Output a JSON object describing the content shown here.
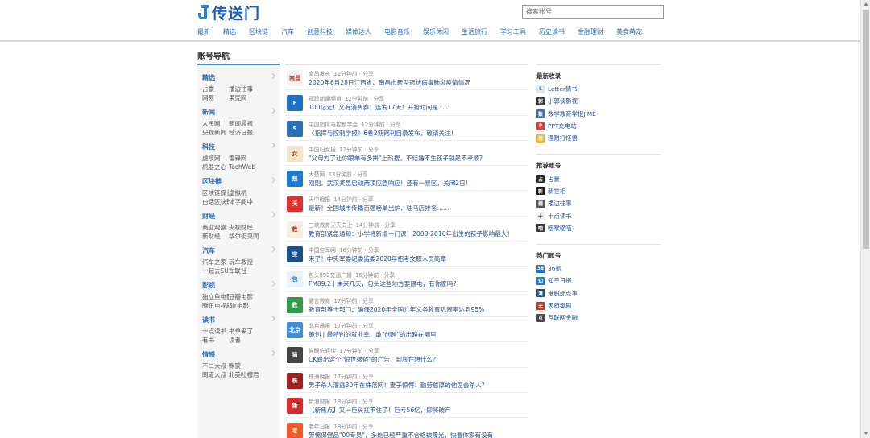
{
  "header": {
    "logo_text": "传送门",
    "search_placeholder": "搜索账号",
    "nav": [
      "最新",
      "精选",
      "区块链",
      "汽车",
      "创意科技",
      "媒体达人",
      "电影音乐",
      "娱乐休闲",
      "生活旅行",
      "学习工具",
      "历史读书",
      "金融理财",
      "美食萌宠"
    ]
  },
  "sidebar": {
    "title": "账号导航",
    "categories": [
      {
        "name": "精选",
        "links": [
          "占豪",
          "播边往事",
          "网易",
          "果壳网"
        ]
      },
      {
        "name": "新闻",
        "links": [
          "人民网",
          "新闻晨报",
          "央视新闻",
          "经济日报"
        ]
      },
      {
        "name": "科技",
        "links": [
          "虎嗅网",
          "雷锋网",
          "机器之心",
          "TechWeb"
        ]
      },
      {
        "name": "区块链",
        "links": [
          "区块链探长",
          "虚拟机",
          "白话区块链",
          "体字阁中"
        ]
      },
      {
        "name": "财经",
        "links": [
          "商业观察",
          "央视财经",
          "新财经",
          "华尔街见闻"
        ]
      },
      {
        "name": "汽车",
        "links": [
          "汽车之家",
          "玩车教授",
          "一起去SUV",
          "车联社"
        ]
      },
      {
        "name": "影视",
        "links": [
          "独立鱼电影",
          "豆瓣电影",
          "腾讯电视剧",
          "Sir电影"
        ]
      },
      {
        "name": "读书",
        "links": [
          "十点读书",
          "书单来了",
          "有书",
          "读者"
        ]
      },
      {
        "name": "情感",
        "links": [
          "不二大叔",
          "咪蒙",
          "同道大叔",
          "北美吐槽君"
        ]
      }
    ]
  },
  "feed": [
    {
      "source": "南昌发布",
      "time": "12分钟前",
      "share": "分享",
      "title": "2020年6月28日江西省、南昌市新型冠状病毒肺炎疫情情况",
      "icon_text": "南昌",
      "icon_color": "#f2f2f2",
      "icon_fg": "#c0392b"
    },
    {
      "source": "福建新闻频道",
      "time": "12分钟前",
      "share": "分享",
      "title": "100亿元！又有消费券！连发17天！开抢时间是……",
      "icon_text": "F",
      "icon_color": "#1f6fc5",
      "icon_fg": "#ffffff"
    },
    {
      "source": "中国指挥与控制学会",
      "time": "12分钟前",
      "share": "分享",
      "title": "《指挥与控制学报》6卷2期网刊目录发布，敬请关注！",
      "icon_text": "S",
      "icon_color": "#2d6fb7",
      "icon_fg": "#ffffff"
    },
    {
      "source": "中国妇女报",
      "time": "12分钟前",
      "share": "分享",
      "title": "\"父母为了让你眼单有多拼\"上热搜，不结婚不生孩子就是不孝顺？",
      "icon_text": "女",
      "icon_color": "#f3e3c8",
      "icon_fg": "#c0392b"
    },
    {
      "source": "大楚网",
      "time": "13分钟前",
      "share": "分享",
      "title": "刚刚，武汉紧急启动两项应急响应！还有一景区，关闭2日！",
      "icon_text": "楚",
      "icon_color": "#1c7ad0",
      "icon_fg": "#ffffff"
    },
    {
      "source": "天中晚报",
      "time": "14分钟前",
      "share": "分享",
      "title": "最新！全国城市传播百强榜单出炉，驻马店排名……",
      "icon_text": "天",
      "icon_color": "#e03131",
      "icon_fg": "#ffffff"
    },
    {
      "source": "三峡教育天天向上",
      "time": "14分钟前",
      "share": "分享",
      "title": "教育部紧急通知：小学将新增一门课！2008-2016年出生的孩子影响最大！",
      "icon_text": "教",
      "icon_color": "#f7efe0",
      "icon_fg": "#b33"
    },
    {
      "source": "中国空军网",
      "time": "16分钟前",
      "share": "分享",
      "title": "来了！中央军委纪委监委2020年招考文职人员简章",
      "icon_text": "空",
      "icon_color": "#1b4f8c",
      "icon_fg": "#ffffff"
    },
    {
      "source": "包头892交通广播",
      "time": "16分钟前",
      "share": "分享",
      "title": "FM89.2 | 未来几天，包头这些地方要限电，有你家吗?",
      "icon_text": "包",
      "icon_color": "#eaf3fb",
      "icon_fg": "#1c7ad0"
    },
    {
      "source": "微言教育",
      "time": "17分钟前",
      "share": "分享",
      "title": "教育部等十部门：确保2020年全国九年义务教育巩固率达到95%",
      "icon_text": "教",
      "icon_color": "#2e9a4a",
      "icon_fg": "#ffffff"
    },
    {
      "source": "北京晨报",
      "time": "17分钟前",
      "share": "分享",
      "title": "策划 | 最特别的就业季，敢\"创跨\"的出路在哪里",
      "icon_text": "北京",
      "icon_color": "#3f8fd6",
      "icon_fg": "#ffffff"
    },
    {
      "source": "猫眼佐轻谈",
      "time": "17分钟前",
      "share": "分享",
      "title": "CK跟出这个\"惊世骇俗\"的广告，到底在想什么？",
      "icon_text": "猫",
      "icon_color": "#444444",
      "icon_fg": "#ffffff"
    },
    {
      "source": "株洲晚报",
      "time": "17分钟前",
      "share": "分享",
      "title": "男子杀人潜逃30年在株落网！妻子惊愕：勤劳憨厚的他怎会杀人?",
      "icon_text": "株",
      "icon_color": "#a31f1f",
      "icon_fg": "#ffffff"
    },
    {
      "source": "新浪财报",
      "time": "18分钟前",
      "share": "分享",
      "title": "【新焦点】又一巨头扛不住了！巨亏56亿，即将破产",
      "icon_text": "新",
      "icon_color": "#d62b2b",
      "icon_fg": "#ffffff"
    },
    {
      "source": "老年日报",
      "time": "18分钟前",
      "share": "分享",
      "title": "警惕保健品\"00专员\"，多处已经严重不合格被曝光，快看你家有没有",
      "icon_text": "老",
      "icon_color": "#f05a28",
      "icon_fg": "#ffffff"
    }
  ],
  "right": {
    "sections": [
      {
        "title": "最新收录",
        "items": [
          {
            "label": "Letter情书",
            "icon_color": "#dfe7f0",
            "icon_text": "L",
            "icon_fg": "#5b7fa8"
          },
          {
            "label": "小郭谈影视",
            "icon_color": "#3a3a3a",
            "icon_text": "郭",
            "icon_fg": "#ffffff"
          },
          {
            "label": "数学教育学报JIME",
            "icon_color": "#3b6db3",
            "icon_text": "数",
            "icon_fg": "#ffffff"
          },
          {
            "label": "PPT充电站",
            "icon_color": "#e03b3b",
            "icon_text": "P",
            "icon_fg": "#ffffff"
          },
          {
            "label": "理财打怪兽",
            "icon_color": "#f2b830",
            "icon_text": "理",
            "icon_fg": "#ffffff"
          }
        ]
      },
      {
        "title": "推荐账号",
        "items": [
          {
            "label": "占豪",
            "icon_color": "#2b2b2b",
            "icon_text": "占",
            "icon_fg": "#ffffff"
          },
          {
            "label": "新世相",
            "icon_color": "#1b1b1b",
            "icon_text": "新",
            "icon_fg": "#ffffff"
          },
          {
            "label": "播边往事",
            "icon_color": "#555555",
            "icon_text": "播",
            "icon_fg": "#ffffff"
          },
          {
            "label": "十点读书",
            "icon_color": "#f1f1f1",
            "icon_text": "十",
            "icon_fg": "#333333"
          },
          {
            "label": "咽喉喵喵",
            "icon_color": "#333333",
            "icon_text": "咽",
            "icon_fg": "#ffffff"
          }
        ]
      },
      {
        "title": "热门账号",
        "items": [
          {
            "label": "36氪",
            "icon_color": "#1d6fd1",
            "icon_text": "36",
            "icon_fg": "#ffffff"
          },
          {
            "label": "知乎日报",
            "icon_color": "#0d7fe0",
            "icon_text": "知",
            "icon_fg": "#ffffff"
          },
          {
            "label": "港股那点事",
            "icon_color": "#1f4e8c",
            "icon_text": "港",
            "icon_fg": "#ffffff"
          },
          {
            "label": "天府泰剧",
            "icon_color": "#c0392b",
            "icon_text": "天",
            "icon_fg": "#ffffff"
          },
          {
            "label": "互联网金融",
            "icon_color": "#4a4a4a",
            "icon_text": "互",
            "icon_fg": "#ffffff"
          }
        ]
      }
    ]
  }
}
